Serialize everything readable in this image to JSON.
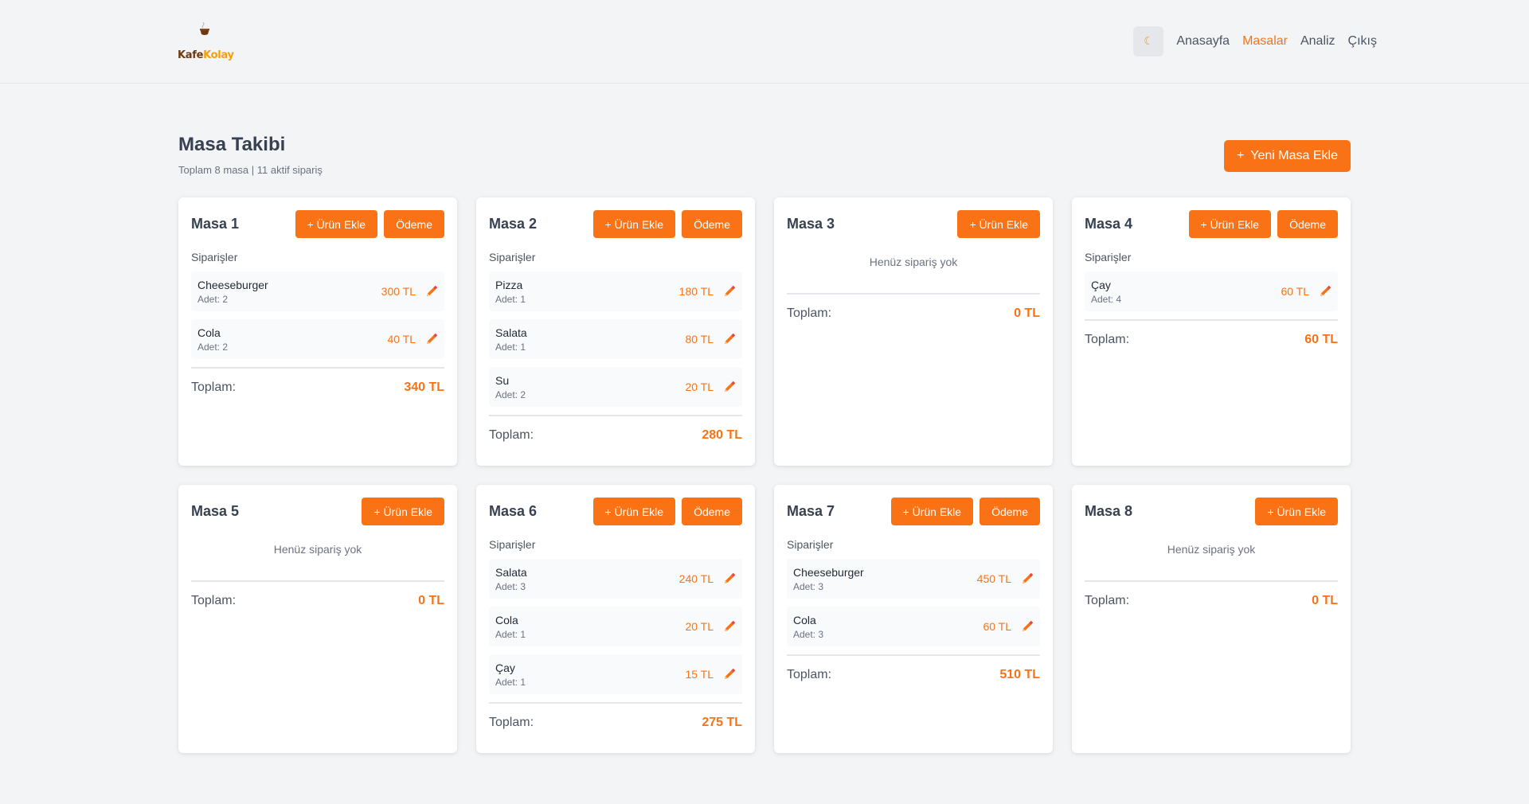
{
  "app": {
    "logo_text_a": "Kafe",
    "logo_text_b": "Kolay"
  },
  "nav": {
    "theme_icon": "☾",
    "links": [
      "Anasayfa",
      "Masalar",
      "Analiz",
      "Çıkış"
    ],
    "active": "Masalar"
  },
  "page": {
    "title": "Masa Takibi",
    "subtitle": "Toplam 8 masa | 11 aktif sipariş",
    "add_button_icon": "+",
    "add_button": "Yeni Masa Ekle"
  },
  "labels": {
    "add_product": "+ Ürün Ekle",
    "payment": "Ödeme",
    "orders": "Siparişler",
    "empty": "Henüz sipariş yok",
    "total": "Toplam:"
  },
  "colors": {
    "accent": "#f97316",
    "background": "#f3f4f6"
  },
  "tables": [
    {
      "name": "Masa 1",
      "payment": true,
      "orders": [
        {
          "name": "Cheeseburger",
          "qty": "Adet: 2",
          "price": "300 TL"
        },
        {
          "name": "Cola",
          "qty": "Adet: 2",
          "price": "40 TL"
        }
      ],
      "total": "340 TL"
    },
    {
      "name": "Masa 2",
      "payment": true,
      "orders": [
        {
          "name": "Pizza",
          "qty": "Adet: 1",
          "price": "180 TL"
        },
        {
          "name": "Salata",
          "qty": "Adet: 1",
          "price": "80 TL"
        },
        {
          "name": "Su",
          "qty": "Adet: 2",
          "price": "20 TL"
        }
      ],
      "total": "280 TL"
    },
    {
      "name": "Masa 3",
      "payment": false,
      "orders": [],
      "total": "0 TL"
    },
    {
      "name": "Masa 4",
      "payment": true,
      "orders": [
        {
          "name": "Çay",
          "qty": "Adet: 4",
          "price": "60 TL"
        }
      ],
      "total": "60 TL"
    },
    {
      "name": "Masa 5",
      "payment": false,
      "orders": [],
      "total": "0 TL"
    },
    {
      "name": "Masa 6",
      "payment": true,
      "orders": [
        {
          "name": "Salata",
          "qty": "Adet: 3",
          "price": "240 TL"
        },
        {
          "name": "Cola",
          "qty": "Adet: 1",
          "price": "20 TL"
        },
        {
          "name": "Çay",
          "qty": "Adet: 1",
          "price": "15 TL"
        }
      ],
      "total": "275 TL"
    },
    {
      "name": "Masa 7",
      "payment": true,
      "orders": [
        {
          "name": "Cheeseburger",
          "qty": "Adet: 3",
          "price": "450 TL"
        },
        {
          "name": "Cola",
          "qty": "Adet: 3",
          "price": "60 TL"
        }
      ],
      "total": "510 TL"
    },
    {
      "name": "Masa 8",
      "payment": false,
      "orders": [],
      "total": "0 TL"
    }
  ]
}
